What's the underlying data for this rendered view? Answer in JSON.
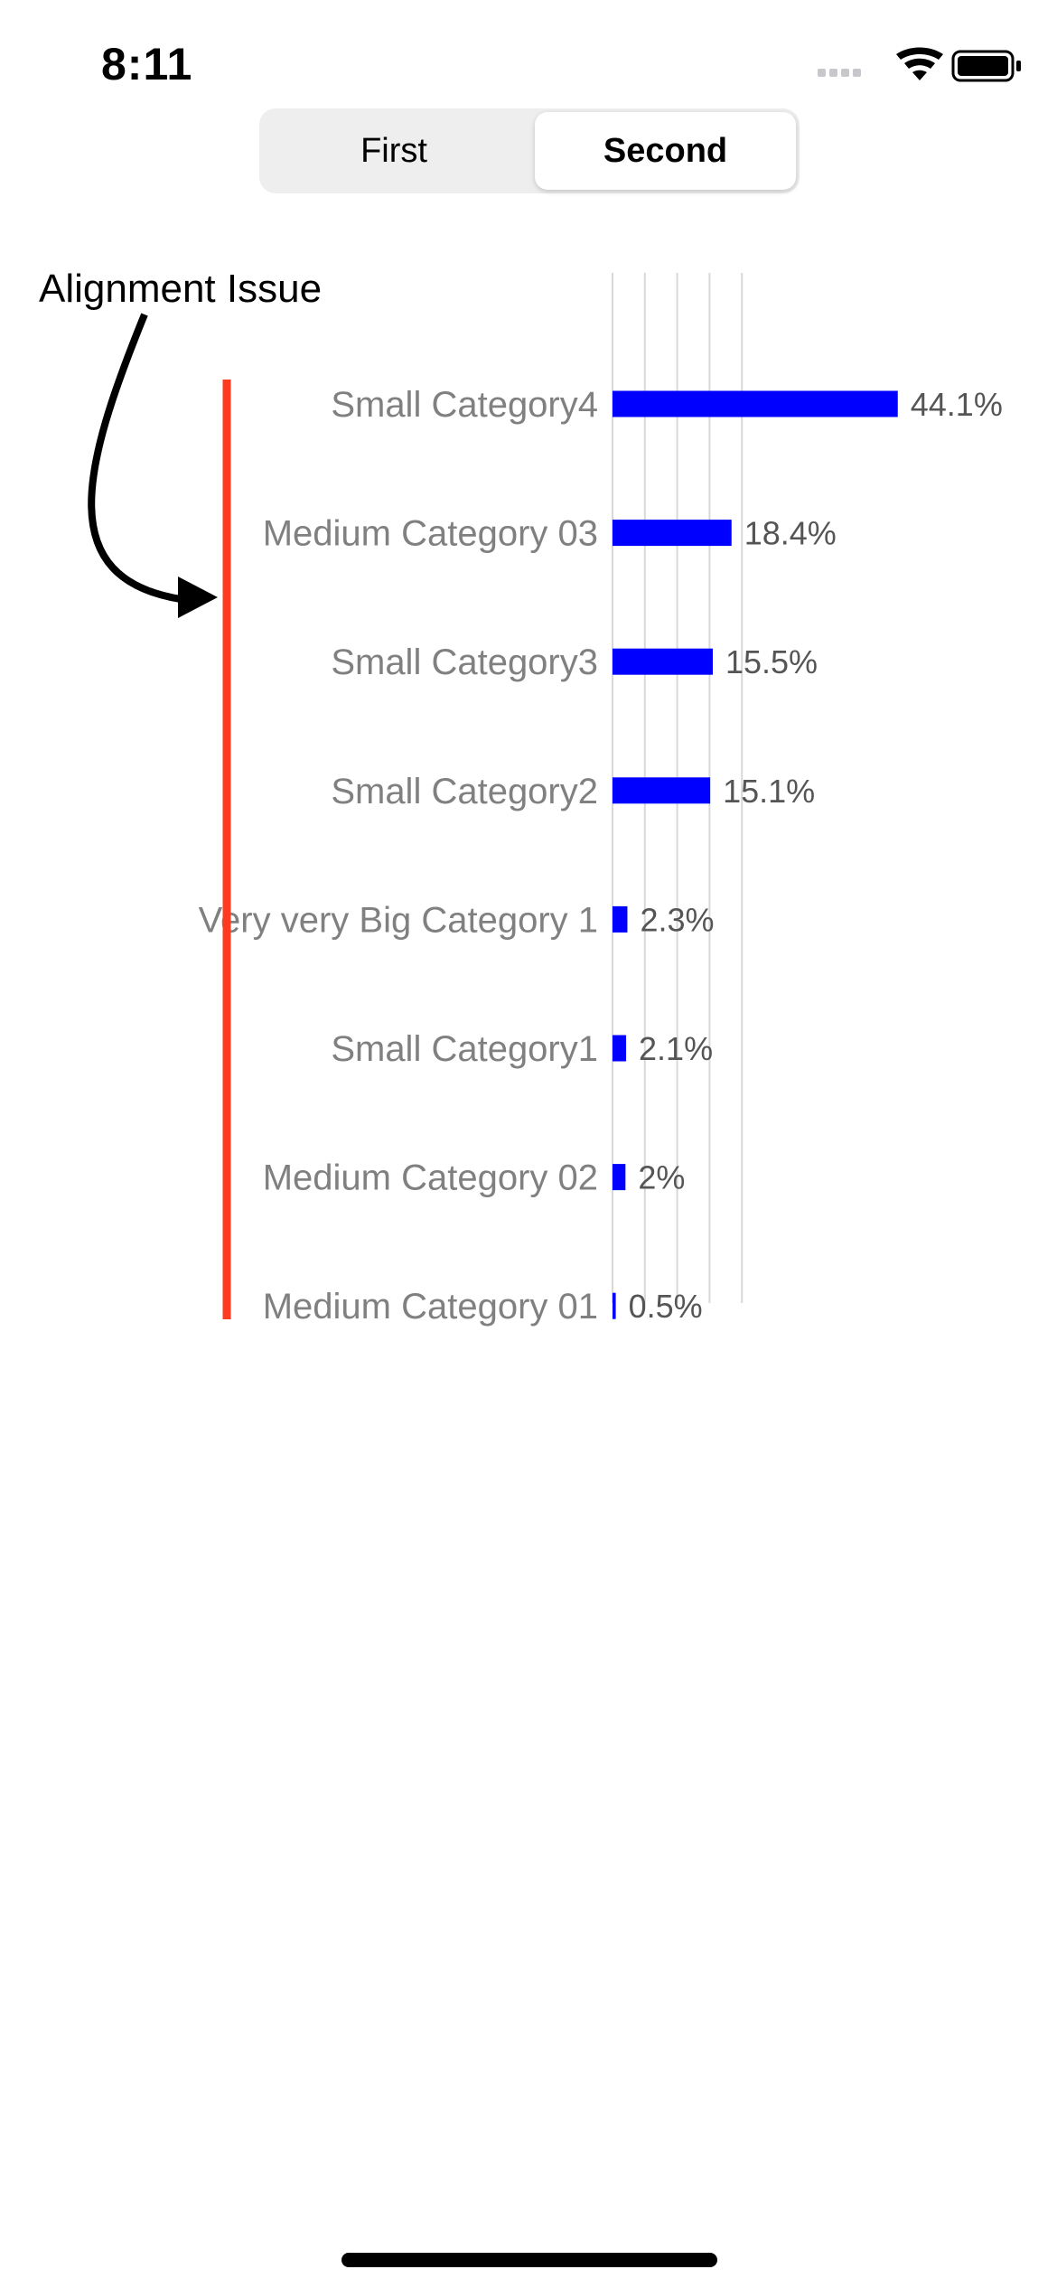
{
  "status_bar": {
    "time": "8:11",
    "icons": [
      "cellular-signal-icon",
      "wifi-icon",
      "battery-icon"
    ]
  },
  "segmented_control": {
    "segments": [
      "First",
      "Second"
    ],
    "selected": "Second"
  },
  "annotation": {
    "text": "Alignment Issue",
    "arrow_color": "#000000",
    "marker_color": "#ff3b1f"
  },
  "chart_data": {
    "type": "bar",
    "orientation": "horizontal",
    "categories": [
      "Small Category4",
      "Medium Category 03",
      "Small Category3",
      "Small Category2",
      "Very very Big Category 1",
      "Small Category1",
      "Medium Category 02",
      "Medium Category 01"
    ],
    "values": [
      44.1,
      18.4,
      15.5,
      15.1,
      2.3,
      2.1,
      2,
      0.5
    ],
    "value_labels": [
      "44.1%",
      "18.4%",
      "15.5%",
      "15.1%",
      "2.3%",
      "2.1%",
      "2%",
      "0.5%"
    ],
    "xlim": [
      0,
      50
    ],
    "grid": true,
    "bar_color": "#0000ff",
    "label_color": "#808080",
    "value_label_color": "#555555"
  }
}
